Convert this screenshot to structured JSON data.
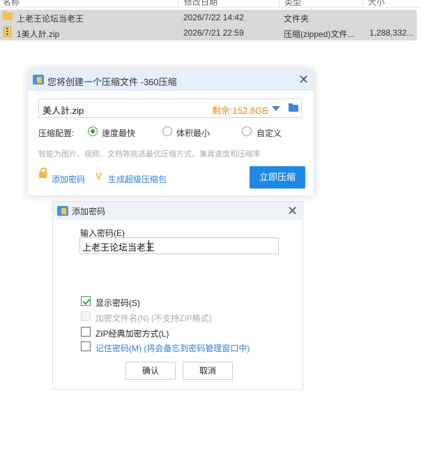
{
  "file_list": {
    "header": {
      "name_col": "名称",
      "date_col": "修改日期",
      "type_col": "类型",
      "size_col": "大小"
    },
    "rows": [
      {
        "icon": "folder-icon",
        "name": "上老王论坛当老王",
        "date": "2026/7/22 14:42",
        "type": "文件夹",
        "size": ""
      },
      {
        "icon": "zip-icon",
        "name": "1美人計.zip",
        "date": "2026/7/21 22:59",
        "type": "压缩(zipped)文件...",
        "size": "1,288,332..."
      }
    ]
  },
  "compress_dialog": {
    "title": "您将创建一个压缩文件 -360压缩",
    "filename": "美人計.zip",
    "remaining_space": "剩余:152.8GB",
    "config_label": "压缩配置:",
    "options": [
      {
        "label": "速度最快",
        "selected": true
      },
      {
        "label": "体积最小",
        "selected": false
      },
      {
        "label": "自定义",
        "selected": false
      }
    ],
    "hint": "智能为图片、视频、文档等挑选最优压缩方式，兼具速度和压缩率",
    "add_password_link": "添加密码",
    "super_package_link": "生成超级压缩包",
    "compress_button": "立即压缩",
    "accent_color": "#1e88e5"
  },
  "password_dialog": {
    "title": "添加密码",
    "input_label": "输入密码(E)",
    "password_value": "上老王论坛当老王",
    "checkboxes": [
      {
        "label": "显示密码(S)",
        "checked": true,
        "disabled": false
      },
      {
        "label": "加密文件名(N) (不支持ZIP格式)",
        "checked": false,
        "disabled": true
      },
      {
        "label": "ZIP经典加密方式(L)",
        "checked": false,
        "disabled": false
      },
      {
        "label": "记住密码(M) (将会备忘到密码管理窗口中)",
        "checked": false,
        "disabled": false
      }
    ],
    "ok_button": "确认",
    "cancel_button": "取消"
  }
}
